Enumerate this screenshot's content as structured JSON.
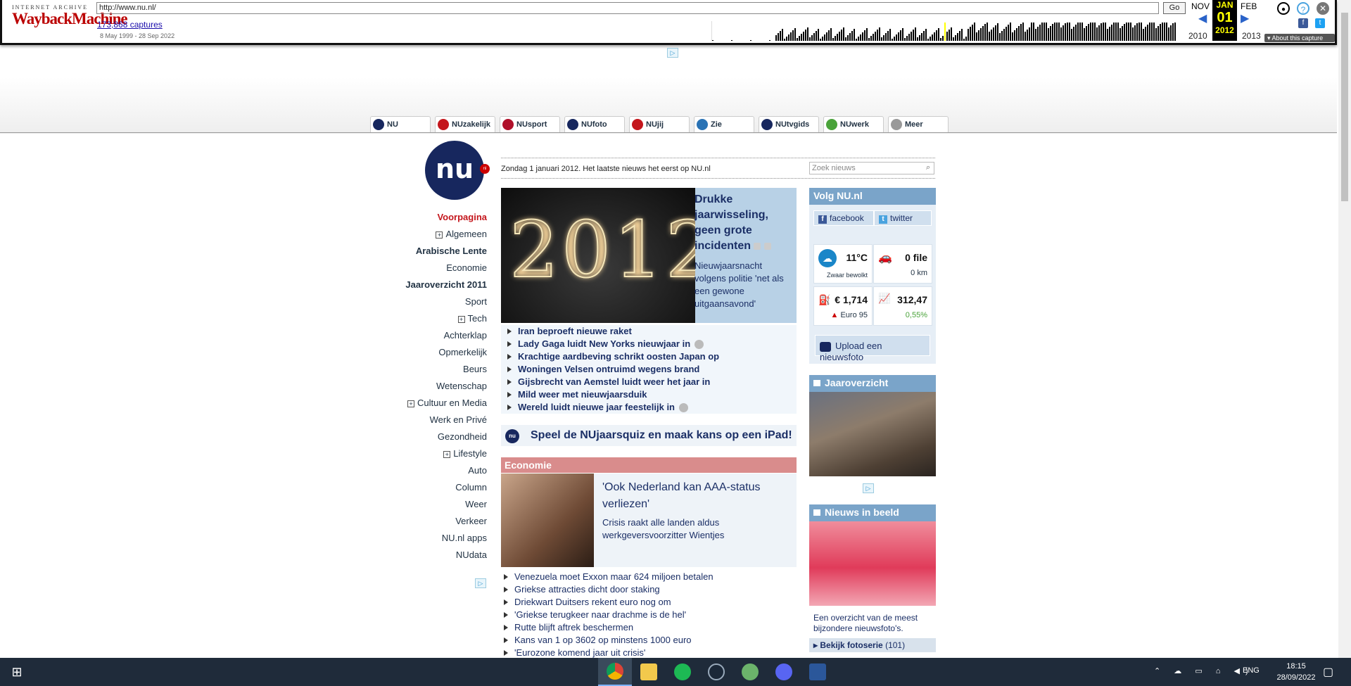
{
  "wayback": {
    "brand_small": "INTERNET ARCHIVE",
    "brand_main": "WaybackMachine",
    "url": "http://www.nu.nl/",
    "go_label": "Go",
    "captures": "173,868 captures",
    "date_range": "8 May 1999 - 28 Sep 2022",
    "prev_month": "NOV",
    "cur_month": "JAN",
    "cur_day": "01",
    "cur_year": "2012",
    "next_month": "FEB",
    "prev_year": "2010",
    "next_year": "2013",
    "about": "About this capture"
  },
  "tabs": [
    {
      "label": "NU",
      "icon": "nu-icon",
      "color": "#17275e"
    },
    {
      "label": "NUzakelijk",
      "icon": "zakelijk-icon",
      "color": "#c4161c"
    },
    {
      "label": "NUsport",
      "icon": "sport-icon",
      "color": "#b0102a"
    },
    {
      "label": "NUfoto",
      "icon": "camera-icon",
      "color": "#17275e"
    },
    {
      "label": "NUjij",
      "icon": "jij-icon",
      "color": "#c4161c"
    },
    {
      "label": "Zie",
      "icon": "play-icon",
      "color": "#2a73b5"
    },
    {
      "label": "NUtvgids",
      "icon": "tv-icon",
      "color": "#17275e"
    },
    {
      "label": "NUwerk",
      "icon": "werk-icon",
      "color": "#4aa33a"
    },
    {
      "label": "Meer",
      "icon": "plus-icon",
      "color": "#999999"
    }
  ],
  "logo": {
    "text": "nu",
    "badge": "nl"
  },
  "sidenav": [
    {
      "label": "Voorpagina",
      "style": "red"
    },
    {
      "label": "Algemeen",
      "style": "plus"
    },
    {
      "label": "Arabische Lente",
      "style": "bold"
    },
    {
      "label": "Economie",
      "style": ""
    },
    {
      "label": "Jaaroverzicht 2011",
      "style": "bold"
    },
    {
      "label": "Sport",
      "style": ""
    },
    {
      "label": "Tech",
      "style": "plus"
    },
    {
      "label": "Achterklap",
      "style": ""
    },
    {
      "label": "Opmerkelijk",
      "style": ""
    },
    {
      "label": "Beurs",
      "style": ""
    },
    {
      "label": "Wetenschap",
      "style": ""
    },
    {
      "label": "Cultuur en Media",
      "style": "plus"
    },
    {
      "label": "Werk en Privé",
      "style": ""
    },
    {
      "label": "Gezondheid",
      "style": ""
    },
    {
      "label": "Lifestyle",
      "style": "plus"
    },
    {
      "label": "Auto",
      "style": ""
    },
    {
      "label": "Column",
      "style": ""
    },
    {
      "label": "Weer",
      "style": ""
    },
    {
      "label": "Verkeer",
      "style": ""
    },
    {
      "label": "NU.nl apps",
      "style": ""
    },
    {
      "label": "NUdata",
      "style": ""
    }
  ],
  "datebar": {
    "text": "Zondag 1 januari 2012. Het laatste nieuws het eerst op NU.nl",
    "search_placeholder": "Zoek nieuws"
  },
  "hero": {
    "image_text": "2012",
    "title": "Drukke jaarwisseling, geen grote incidenten",
    "desc": "Nieuwjaarsnacht volgens politie 'net als een gewone uitgaansavond'"
  },
  "headlines": [
    {
      "text": "Iran beproeft nieuwe raket",
      "cam": false
    },
    {
      "text": "Lady Gaga luidt New Yorks nieuwjaar in",
      "cam": true
    },
    {
      "text": "Krachtige aardbeving schrikt oosten Japan op",
      "cam": false
    },
    {
      "text": "Woningen Velsen ontruimd wegens brand",
      "cam": false
    },
    {
      "text": "Gijsbrecht van Aemstel luidt weer het jaar in",
      "cam": false
    },
    {
      "text": "Mild weer met nieuwjaarsduik",
      "cam": false
    },
    {
      "text": "Wereld luidt nieuwe jaar feestelijk in",
      "cam": true
    }
  ],
  "quiz": {
    "icon_text": "nu",
    "text": "Speel de NUjaarsquiz en maak kans op een iPad!"
  },
  "economie": {
    "header": "Economie",
    "title": "'Ook Nederland kan AAA-status verliezen'",
    "desc": "Crisis raakt alle landen aldus werkgeversvoorzitter Wientjes",
    "list": [
      "Venezuela moet Exxon maar 624 miljoen betalen",
      "Griekse attracties dicht door staking",
      "Driekwart Duitsers rekent euro nog om",
      "'Griekse terugkeer naar drachme is de hel'",
      "Rutte blijft aftrek beschermen",
      "Kans van 1 op 3602 op minstens 1000 euro",
      "'Eurozone komend jaar uit crisis'"
    ]
  },
  "right": {
    "follow_title": "Volg NU.nl",
    "facebook": "facebook",
    "twitter": "twitter",
    "weather_temp": "11°C",
    "weather_desc": "Zwaar bewolkt",
    "traffic_files": "0 file",
    "traffic_km": "0 km",
    "fuel_price": "€ 1,714",
    "fuel_type": "Euro 95",
    "index_value": "312,47",
    "index_change": "0,55%",
    "upload": "Upload een nieuwsfoto",
    "jaaroverzicht": "Jaaroverzicht",
    "nieuws_in_beeld": "Nieuws in beeld",
    "nib_desc": "Een overzicht van de meest bijzondere nieuwsfoto's.",
    "fotoserie": "Bekijk fotoserie",
    "fotoserie_count": "(101)"
  },
  "taskbar": {
    "time": "18:15",
    "date": "28/09/2022",
    "lang": "ENG"
  },
  "colors": {
    "nu_blue": "#17275e",
    "nu_red": "#c4161c",
    "header_blue": "#7aa4c9",
    "eco_red": "#d98c8c"
  }
}
